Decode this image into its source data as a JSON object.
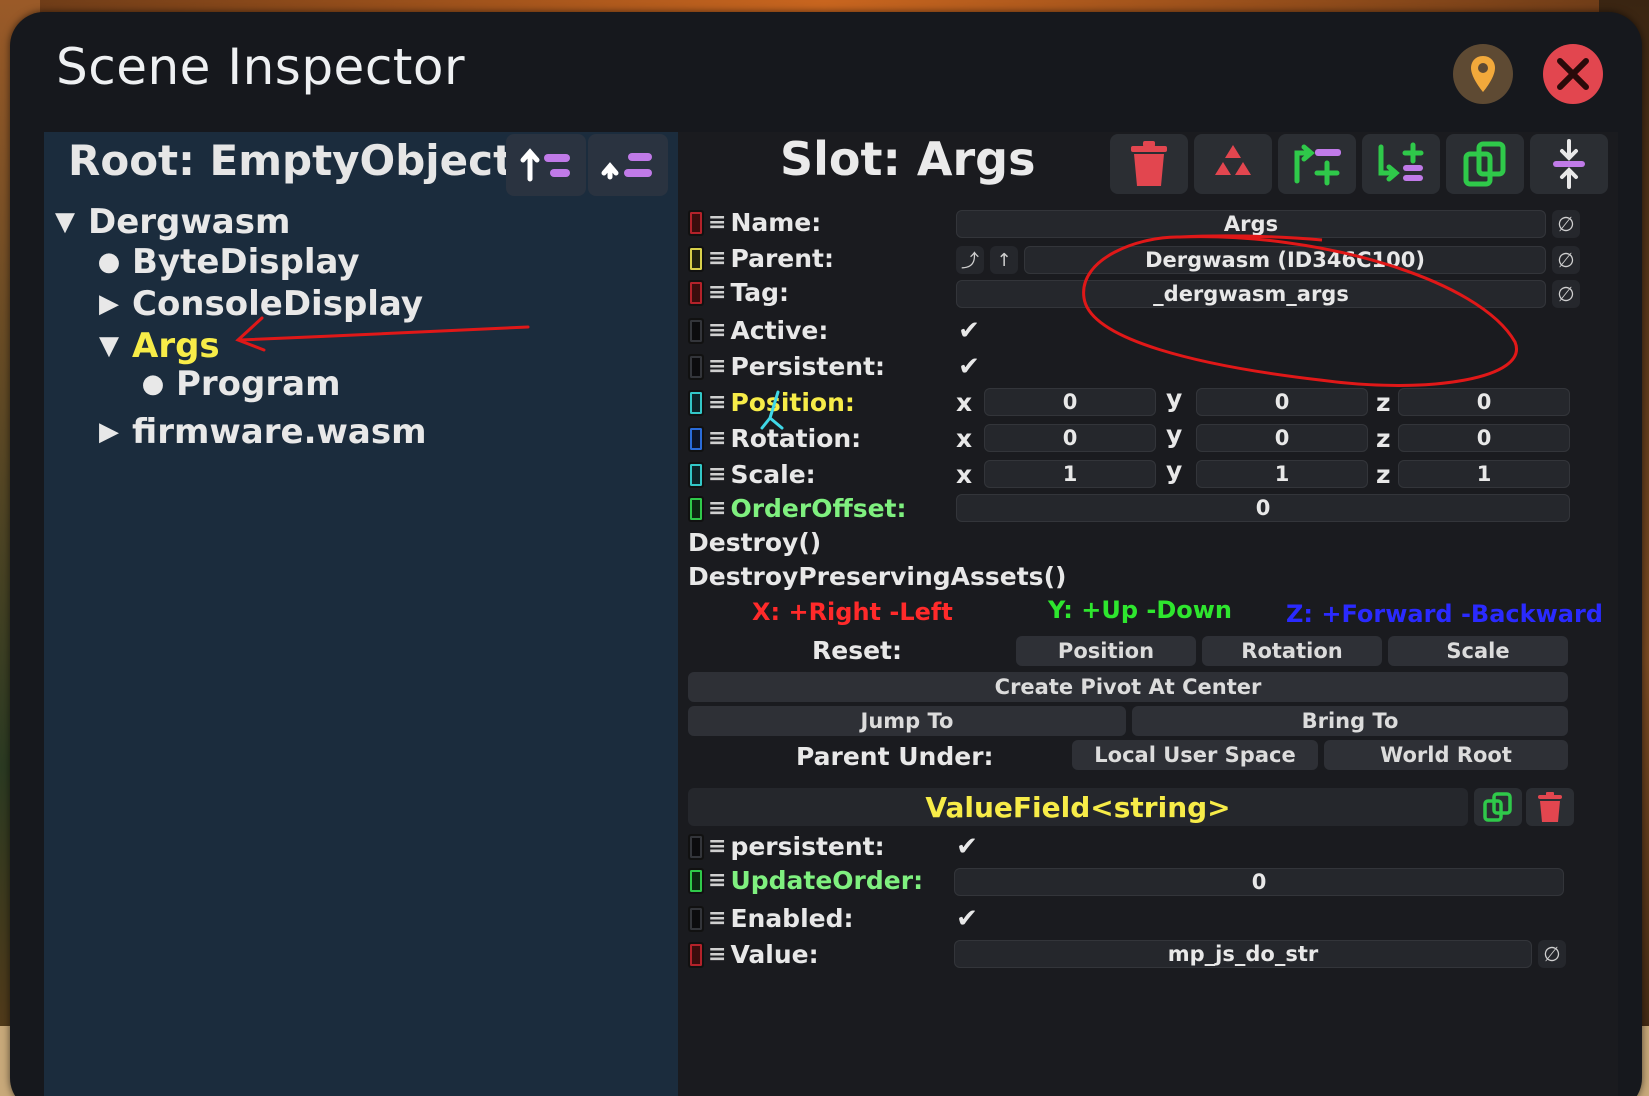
{
  "window": {
    "title": "Scene Inspector",
    "location_icon": "map-pin-icon",
    "close_icon": "close-icon"
  },
  "hierarchy": {
    "root_label": "Root: EmptyObject",
    "nodes": [
      {
        "label": "Dergwasm",
        "state": "expanded"
      },
      {
        "label": "ByteDisplay",
        "state": "leaf"
      },
      {
        "label": "ConsoleDisplay",
        "state": "collapsed"
      },
      {
        "label": "Args",
        "state": "expanded",
        "selected": true
      },
      {
        "label": "Program",
        "state": "leaf"
      },
      {
        "label": "firmware.wasm",
        "state": "collapsed"
      }
    ]
  },
  "slot": {
    "title": "Slot: Args",
    "fields": {
      "name_label": "Name:",
      "name_value": "Args",
      "parent_label": "Parent:",
      "parent_value": "Dergwasm (ID346C100)",
      "tag_label": "Tag:",
      "tag_value": "_dergwasm_args",
      "active_label": "Active:",
      "persistent_label": "Persistent:",
      "position_label": "Position:",
      "rotation_label": "Rotation:",
      "scale_label": "Scale:",
      "orderoffset_label": "OrderOffset:",
      "orderoffset_value": "0"
    },
    "position": {
      "x": "0",
      "y": "0",
      "z": "0"
    },
    "rotation": {
      "x": "0",
      "y": "0",
      "z": "0"
    },
    "scale": {
      "x": "1",
      "y": "1",
      "z": "1"
    },
    "axis_labels": {
      "x": "x",
      "y": "y",
      "z": "z"
    },
    "methods": [
      "Destroy()",
      "DestroyPreservingAssets()"
    ],
    "hints": {
      "x": "X: +Right -Left",
      "y": "Y: +Up -Down",
      "z": "Z: +Forward -Backward",
      "x_color": "#ff2a2a",
      "y_color": "#2ee62e",
      "z_color": "#2a2aff"
    },
    "reset": {
      "label": "Reset:",
      "buttons": [
        "Position",
        "Rotation",
        "Scale"
      ]
    },
    "create_pivot": "Create Pivot At Center",
    "jump_to": "Jump To",
    "bring_to": "Bring To",
    "parent_under": {
      "label": "Parent Under:",
      "buttons": [
        "Local User Space",
        "World Root"
      ]
    }
  },
  "component": {
    "title": "ValueField<string>",
    "fields": {
      "persistent_label": "persistent:",
      "updateorder_label": "UpdateOrder:",
      "updateorder_value": "0",
      "enabled_label": "Enabled:",
      "value_label": "Value:",
      "value_value": "mp_js_do_str"
    }
  },
  "colors": {
    "selected_node": "#f7ec48",
    "delete_red": "#e2464f",
    "add_green": "#2fc94a"
  }
}
